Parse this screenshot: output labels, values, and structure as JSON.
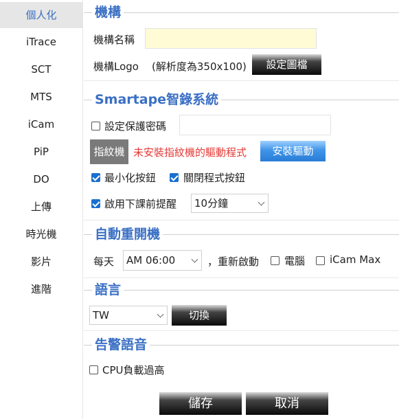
{
  "sidebar": {
    "items": [
      {
        "label": "個人化"
      },
      {
        "label": "iTrace"
      },
      {
        "label": "SCT"
      },
      {
        "label": "MTS"
      },
      {
        "label": "iCam"
      },
      {
        "label": "PiP"
      },
      {
        "label": "DO"
      },
      {
        "label": "上傳"
      },
      {
        "label": "時光機"
      },
      {
        "label": "影片"
      },
      {
        "label": "進階"
      }
    ]
  },
  "org": {
    "title": "機構",
    "name_label": "機構名稱",
    "name_value": "",
    "logo_label": "機構Logo",
    "logo_hint": "(解析度為350x100)",
    "logo_button": "設定圖檔"
  },
  "smartape": {
    "title": "Smartape智錄系統",
    "password_label": "設定保護密碼",
    "password_checked": false,
    "password_value": "",
    "fingerprint_badge": "指紋機",
    "fingerprint_warning": "未安裝指紋機的驅動程式",
    "install_driver_button": "安裝驅動",
    "minimize_label": "最小化按鈕",
    "minimize_checked": true,
    "close_label": "關閉程式按鈕",
    "close_checked": true,
    "reminder_label": "啟用下課前提醒",
    "reminder_checked": true,
    "reminder_value": "10分鐘"
  },
  "restart": {
    "title": "自動重開機",
    "daily_label": "每天",
    "time_value": "AM 06:00",
    "restart_label": "，重新啟動",
    "pc_label": "電腦",
    "pc_checked": false,
    "icam_label": "iCam Max",
    "icam_checked": false
  },
  "language": {
    "title": "語言",
    "value": "TW",
    "switch_button": "切換"
  },
  "alert": {
    "title": "告警語音",
    "cpu_label": "CPU負載過高",
    "cpu_checked": false
  },
  "footer": {
    "save_button": "儲存",
    "cancel_button": "取消"
  },
  "colors": {
    "accent": "#3a6fc4",
    "warning": "#e53935",
    "checkbox": "#1a6fd0",
    "name_field_bg": "#fffbd5"
  }
}
